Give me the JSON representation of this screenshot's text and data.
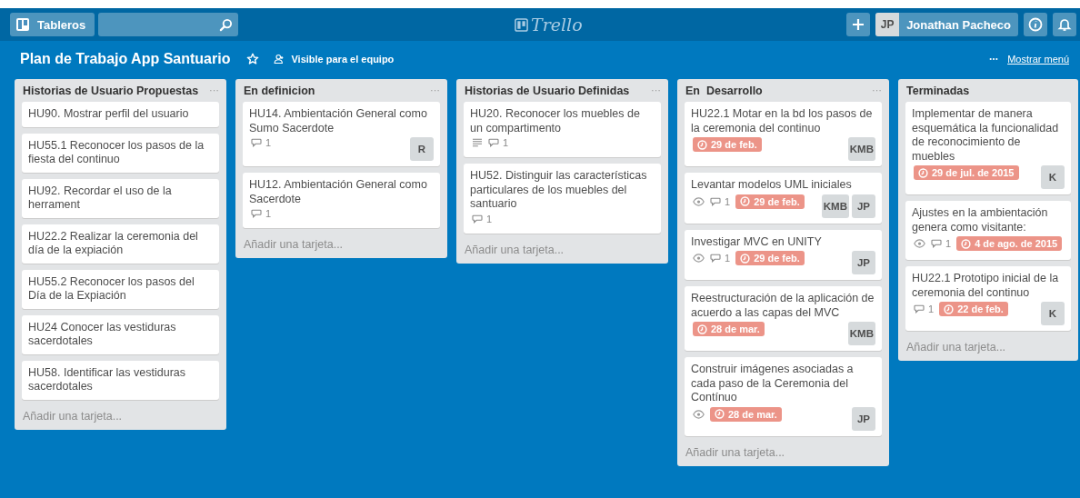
{
  "header": {
    "boards_button": "Tableros",
    "logo": "Trello",
    "user": {
      "initials": "JP",
      "name": "Jonathan Pacheco"
    }
  },
  "board": {
    "title": "Plan de Trabajo App Santuario",
    "starred": false,
    "visibility": "Visible para el equipo",
    "menu_link": "Mostrar menú"
  },
  "lists": [
    {
      "title": "Historias de Usuario Propuestas",
      "menu": "···",
      "add_card": "Añadir una tarjeta...",
      "cards": [
        {
          "title": "HU90. Mostrar perfil del usuario"
        },
        {
          "title": "HU55.1 Reconocer los pasos de la fiesta del continuo"
        },
        {
          "title": "HU92. Recordar el uso de la herrament"
        },
        {
          "title": "HU22.2 Realizar la ceremonia del día de la expiación"
        },
        {
          "title": "HU55.2 Reconocer los pasos del Día de la Expiación"
        },
        {
          "title": "HU24 Conocer las vestiduras sacerdotales"
        },
        {
          "title": "HU58. Identificar las vestiduras sacerdotales"
        }
      ]
    },
    {
      "title": "En definicion",
      "menu": "···",
      "add_card": "Añadir una tarjeta...",
      "cards": [
        {
          "title": "HU14. Ambientación General como Sumo Sacerdote",
          "badges": [
            {
              "kind": "comments",
              "text": "1"
            }
          ],
          "members": [
            {
              "initials": "R"
            }
          ]
        },
        {
          "title": "HU12. Ambientación General como Sacerdote",
          "badges": [
            {
              "kind": "comments",
              "text": "1"
            }
          ]
        }
      ]
    },
    {
      "title": "Historias de Usuario Definidas",
      "menu": "···",
      "add_card": "Añadir una tarjeta...",
      "cards": [
        {
          "title": "HU20. Reconocer los muebles de un compartimento",
          "badges": [
            {
              "kind": "description"
            },
            {
              "kind": "comments",
              "text": "1"
            }
          ]
        },
        {
          "title": "HU52. Distinguir las características particulares de los muebles del santuario",
          "badges": [
            {
              "kind": "comments",
              "text": "1"
            }
          ]
        }
      ]
    },
    {
      "title": "En  Desarrollo",
      "menu": "···",
      "add_card": "Añadir una tarjeta...",
      "cards": [
        {
          "title": "HU22.1 Motar en la bd los pasos de la ceremonia del continuo",
          "badges": [
            {
              "kind": "due",
              "text": "29 de feb."
            }
          ],
          "members": [
            {
              "initials": "KMB"
            }
          ]
        },
        {
          "title": "Levantar modelos UML iniciales",
          "badges": [
            {
              "kind": "watch"
            },
            {
              "kind": "comments",
              "text": "1"
            },
            {
              "kind": "due",
              "text": "29 de feb."
            }
          ],
          "members": [
            {
              "initials": "KMB"
            },
            {
              "initials": "JP"
            }
          ]
        },
        {
          "title": "Investigar MVC en UNITY",
          "badges": [
            {
              "kind": "watch"
            },
            {
              "kind": "comments",
              "text": "1"
            },
            {
              "kind": "due",
              "text": "29 de feb."
            }
          ],
          "members": [
            {
              "initials": "JP"
            }
          ]
        },
        {
          "title": "Reestructuración de la aplicación de acuerdo a las capas del MVC",
          "badges": [
            {
              "kind": "due",
              "text": "28 de mar."
            }
          ],
          "members": [
            {
              "initials": "KMB"
            }
          ]
        },
        {
          "title": "Construir imágenes asociadas a cada paso de la Ceremonia del Contínuo",
          "badges": [
            {
              "kind": "watch"
            },
            {
              "kind": "due",
              "text": "28 de mar."
            }
          ],
          "members": [
            {
              "initials": "JP"
            }
          ]
        }
      ]
    },
    {
      "title": "Terminadas",
      "add_card": "Añadir una tarjeta...",
      "cards": [
        {
          "title": "Implementar de manera esquemática la funcionalidad de reconocimiento de muebles",
          "badges": [
            {
              "kind": "due",
              "text": "29 de jul. de 2015"
            }
          ],
          "members": [
            {
              "initials": "K"
            }
          ]
        },
        {
          "title": "Ajustes en la ambientación genera como visitante:",
          "badges": [
            {
              "kind": "watch"
            },
            {
              "kind": "comments",
              "text": "1"
            },
            {
              "kind": "due",
              "text": "4 de ago. de 2015"
            }
          ]
        },
        {
          "title": "HU22.1 Prototipo inicial de la ceremonia del continuo",
          "badges": [
            {
              "kind": "comments",
              "text": "1"
            },
            {
              "kind": "due",
              "text": "22 de feb."
            }
          ],
          "members": [
            {
              "initials": "K"
            }
          ]
        }
      ]
    }
  ]
}
